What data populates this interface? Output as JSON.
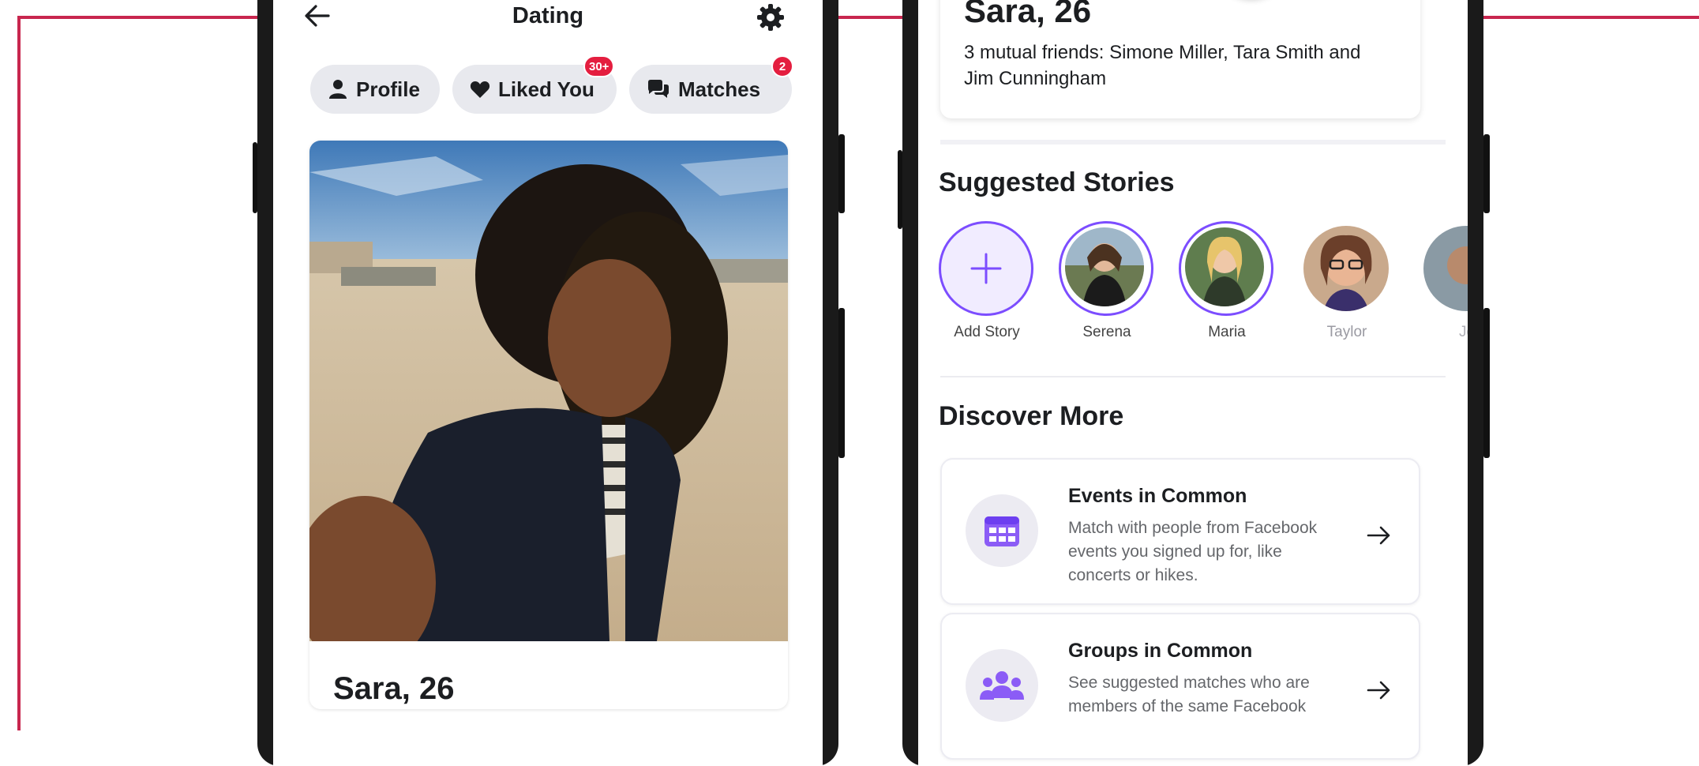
{
  "left_screen": {
    "title": "Dating",
    "chips": [
      {
        "label": "Profile",
        "icon": "person-icon",
        "badge": ""
      },
      {
        "label": "Liked You",
        "icon": "heart-icon",
        "badge": "30+"
      },
      {
        "label": "Matches",
        "icon": "chat-bubbles-icon",
        "badge": "2"
      }
    ],
    "card": {
      "name": "Sara, 26"
    }
  },
  "right_screen": {
    "profile": {
      "name": "Sara, 26",
      "mutual_friends": "3 mutual friends: Simone Miller, Tara Smith and Jim Cunningham"
    },
    "suggested_stories": {
      "title": "Suggested Stories",
      "items": [
        {
          "label": "Add Story"
        },
        {
          "label": "Serena"
        },
        {
          "label": "Maria"
        },
        {
          "label": "Taylor"
        },
        {
          "label": "Jo"
        }
      ]
    },
    "discover_more": {
      "title": "Discover More",
      "items": [
        {
          "title": "Events in Common",
          "description": "Match with people from Facebook events you signed up for, like concerts or hikes.",
          "icon": "calendar-icon"
        },
        {
          "title": "Groups in Common",
          "description": "See suggested matches who are members of the same Facebook",
          "icon": "group-icon"
        }
      ]
    }
  },
  "colors": {
    "frame": "#c8264e",
    "accent_purple": "#8b5cf6",
    "badge_red": "#e41e3f",
    "chip_bg": "#e8e9ee"
  }
}
